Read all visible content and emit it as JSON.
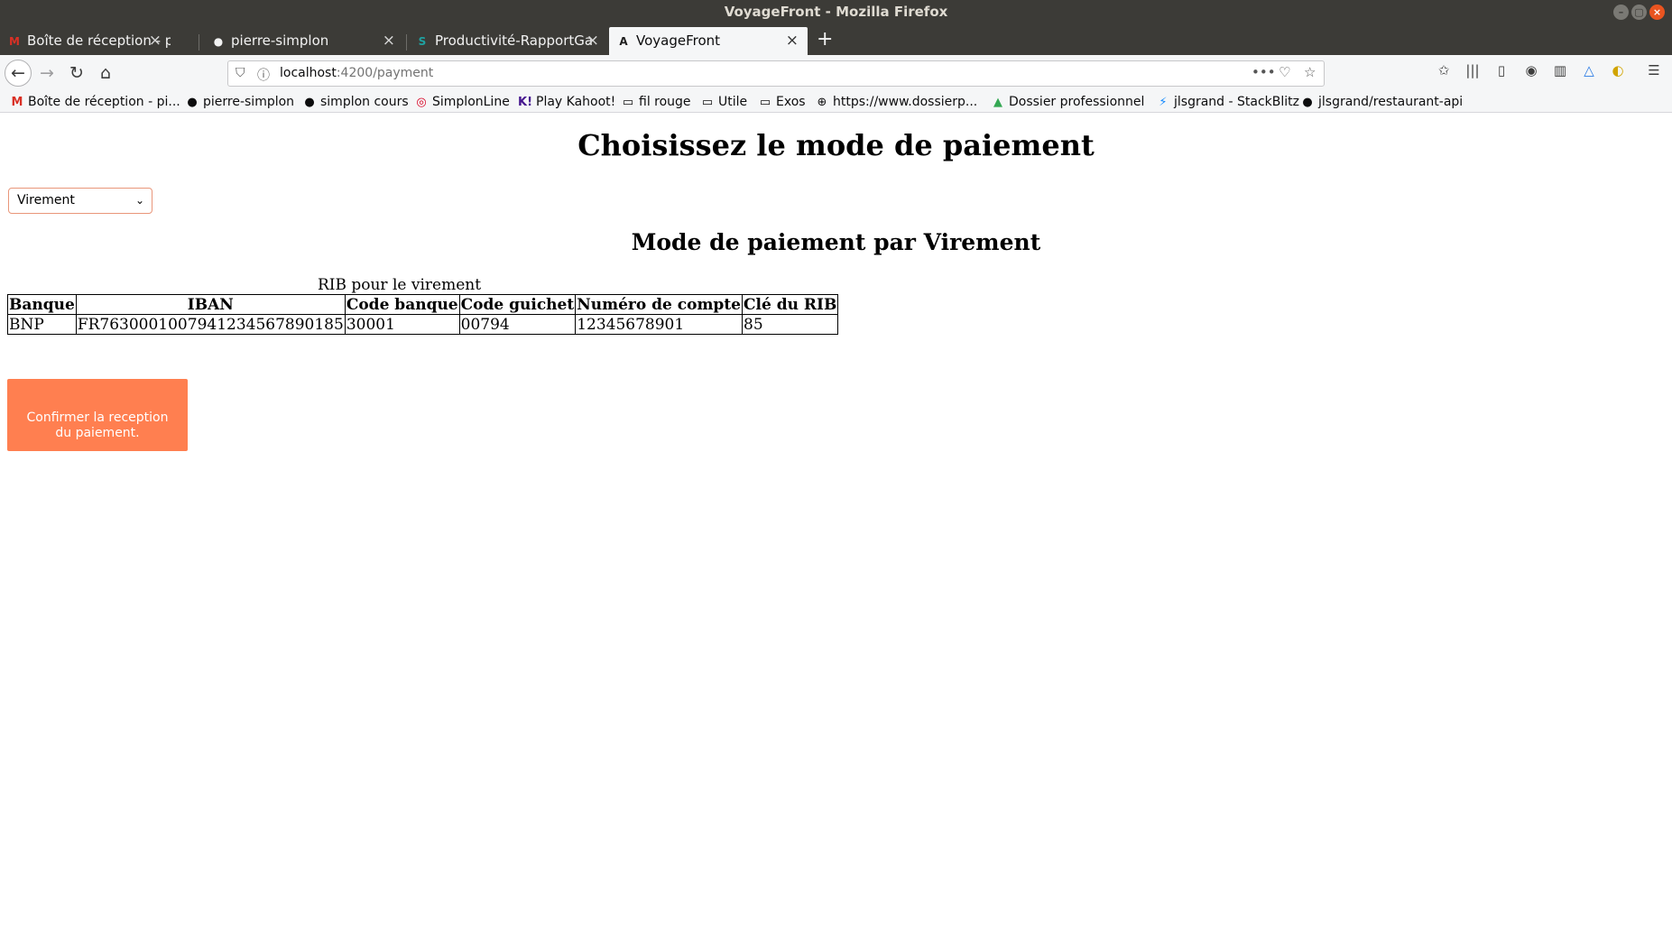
{
  "window": {
    "title": "VoyageFront - Mozilla Firefox",
    "controls": [
      "–",
      "▢",
      "×"
    ]
  },
  "tabs": [
    {
      "label": "Boîte de réception - pierre",
      "icon": "M",
      "icon_color": "#d93025",
      "active": false
    },
    {
      "label": "pierre-simplon",
      "icon": "●",
      "icon_color": "#f2f2f2",
      "active": false
    },
    {
      "label": "Productivité-RapportGal",
      "icon": "S",
      "icon_color": "#1fa2a2",
      "active": false
    },
    {
      "label": "VoyageFront",
      "icon": "A",
      "icon_color": "#1f1f1f",
      "active": true
    }
  ],
  "tab_close": "×",
  "new_tab": "+",
  "nav": {
    "back": "←",
    "forward": "→",
    "reload": "↻",
    "home": "⌂",
    "url_host": "localhost",
    "url_path": ":4200/payment",
    "page_actions": "•••",
    "pocket": "♡",
    "star": "☆"
  },
  "toolbar_icons": [
    {
      "name": "bookmark-star-icon",
      "glyph": "✩"
    },
    {
      "name": "library-icon",
      "glyph": "|||"
    },
    {
      "name": "sidebar-icon",
      "glyph": "▯"
    },
    {
      "name": "account-icon",
      "glyph": "◉"
    },
    {
      "name": "extension-icon",
      "glyph": "▥"
    },
    {
      "name": "drive-extension-icon",
      "glyph": "△"
    },
    {
      "name": "extension-moon-icon",
      "glyph": "◐"
    },
    {
      "name": "menu-icon",
      "glyph": "☰"
    }
  ],
  "bookmarks": [
    {
      "label": "Boîte de réception - pi...",
      "icon": "M",
      "icon_color": "#d93025"
    },
    {
      "label": "pierre-simplon",
      "icon": "●",
      "icon_color": "#1b1b1b"
    },
    {
      "label": "simplon cours",
      "icon": "●",
      "icon_color": "#1b1b1b"
    },
    {
      "label": "SimplonLine",
      "icon": "◎",
      "icon_color": "#d70022"
    },
    {
      "label": "Play Kahoot!",
      "icon": "K!",
      "icon_color": "#46178f"
    },
    {
      "label": "fil rouge",
      "icon": "▭",
      "icon_color": "#555555"
    },
    {
      "label": "Utile",
      "icon": "▭",
      "icon_color": "#555555"
    },
    {
      "label": "Exos",
      "icon": "▭",
      "icon_color": "#555555"
    },
    {
      "label": "https://www.dossierp...",
      "icon": "⊕",
      "icon_color": "#555555"
    },
    {
      "label": "Dossier professionnel",
      "icon": "▲",
      "icon_color": "#34a853"
    },
    {
      "label": "jlsgrand - StackBlitz",
      "icon": "⚡",
      "icon_color": "#1389fd"
    },
    {
      "label": "jlsgrand/restaurant-api",
      "icon": "●",
      "icon_color": "#1b1b1b"
    }
  ],
  "page": {
    "title": "Choisissez le mode de paiement",
    "payment_mode_selected": "Virement",
    "select_chevron": "⌄",
    "section_title": "Mode de paiement par Virement",
    "table_caption": "RIB pour le virement",
    "table_headers": [
      "Banque",
      "IBAN",
      "Code banque",
      "Code guichet",
      "Numéro de compte",
      "Clé du RIB"
    ],
    "table_rows": [
      [
        "BNP",
        "FR7630001007941234567890185",
        "30001",
        "00794",
        "12345678901",
        "85"
      ]
    ],
    "confirm_button": "Confirmer la reception du paiement.",
    "confirm_button_color": "#ff7f50"
  }
}
